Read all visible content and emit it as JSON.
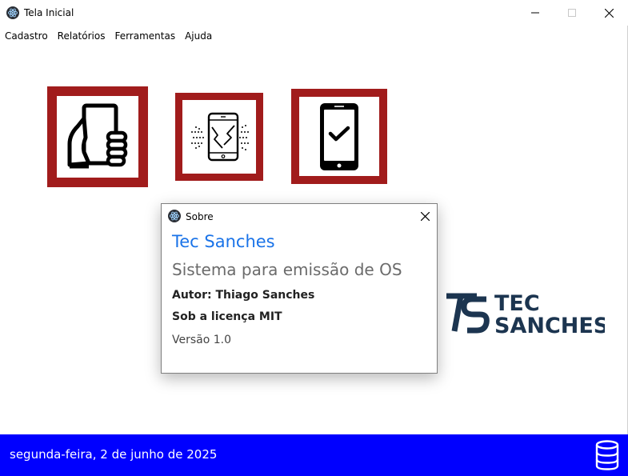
{
  "window": {
    "title": "Tela Inicial"
  },
  "menu": {
    "items": [
      {
        "label": "Cadastro"
      },
      {
        "label": "Relatórios"
      },
      {
        "label": "Ferramentas"
      },
      {
        "label": "Ajuda"
      }
    ]
  },
  "tiles": [
    {
      "icon": "hand-holding-phone-icon"
    },
    {
      "icon": "broken-phone-icon"
    },
    {
      "icon": "phone-check-icon"
    }
  ],
  "logo": {
    "line1": "TEC",
    "line2": "SANCHES",
    "color": "#1c3550"
  },
  "about_dialog": {
    "title": "Sobre",
    "heading": "Tec Sanches",
    "subtitle": "Sistema para emissão de OS",
    "author": "Autor: Thiago Sanches",
    "license": "Sob a licença MIT",
    "version": "Versão 1.0"
  },
  "statusbar": {
    "date": "segunda-feira, 2 de junho de 2025",
    "icon": "database-icon"
  },
  "colors": {
    "tile_border": "#a11c1c",
    "statusbar_bg": "#0000ff",
    "heading": "#1a73e8"
  }
}
